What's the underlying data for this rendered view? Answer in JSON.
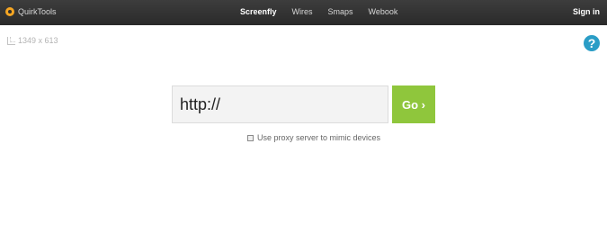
{
  "header": {
    "brand": "QuirkTools",
    "nav": [
      {
        "label": "Screenfly",
        "active": true
      },
      {
        "label": "Wires",
        "active": false
      },
      {
        "label": "Smaps",
        "active": false
      },
      {
        "label": "Webook",
        "active": false
      }
    ],
    "signin": "Sign in"
  },
  "screen_info": {
    "dimensions": "1349 x 613",
    "icon": "ruler-icon"
  },
  "help": {
    "label": "?"
  },
  "url": {
    "value": "http://",
    "button": "Go ›"
  },
  "proxy": {
    "label": "Use proxy server to mimic devices",
    "checked": false
  },
  "colors": {
    "topbar": "#333333",
    "go": "#8fc63c",
    "help": "#2a9dc6",
    "brand_accent": "#f5a623"
  }
}
